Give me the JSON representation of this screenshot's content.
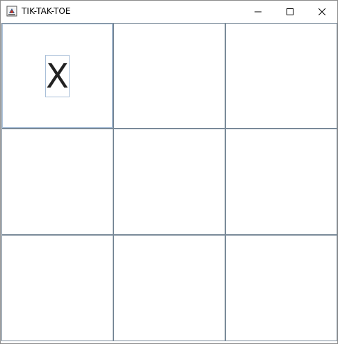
{
  "window": {
    "title": "TIK-TAK-TOE",
    "icon": "java-app-icon",
    "controls": [
      "minimize-icon",
      "maximize-icon",
      "close-icon"
    ]
  },
  "board": {
    "cells": [
      [
        "X",
        "",
        ""
      ],
      [
        "",
        "",
        ""
      ],
      [
        "",
        "",
        ""
      ]
    ],
    "focused_cell": [
      0,
      0
    ]
  }
}
